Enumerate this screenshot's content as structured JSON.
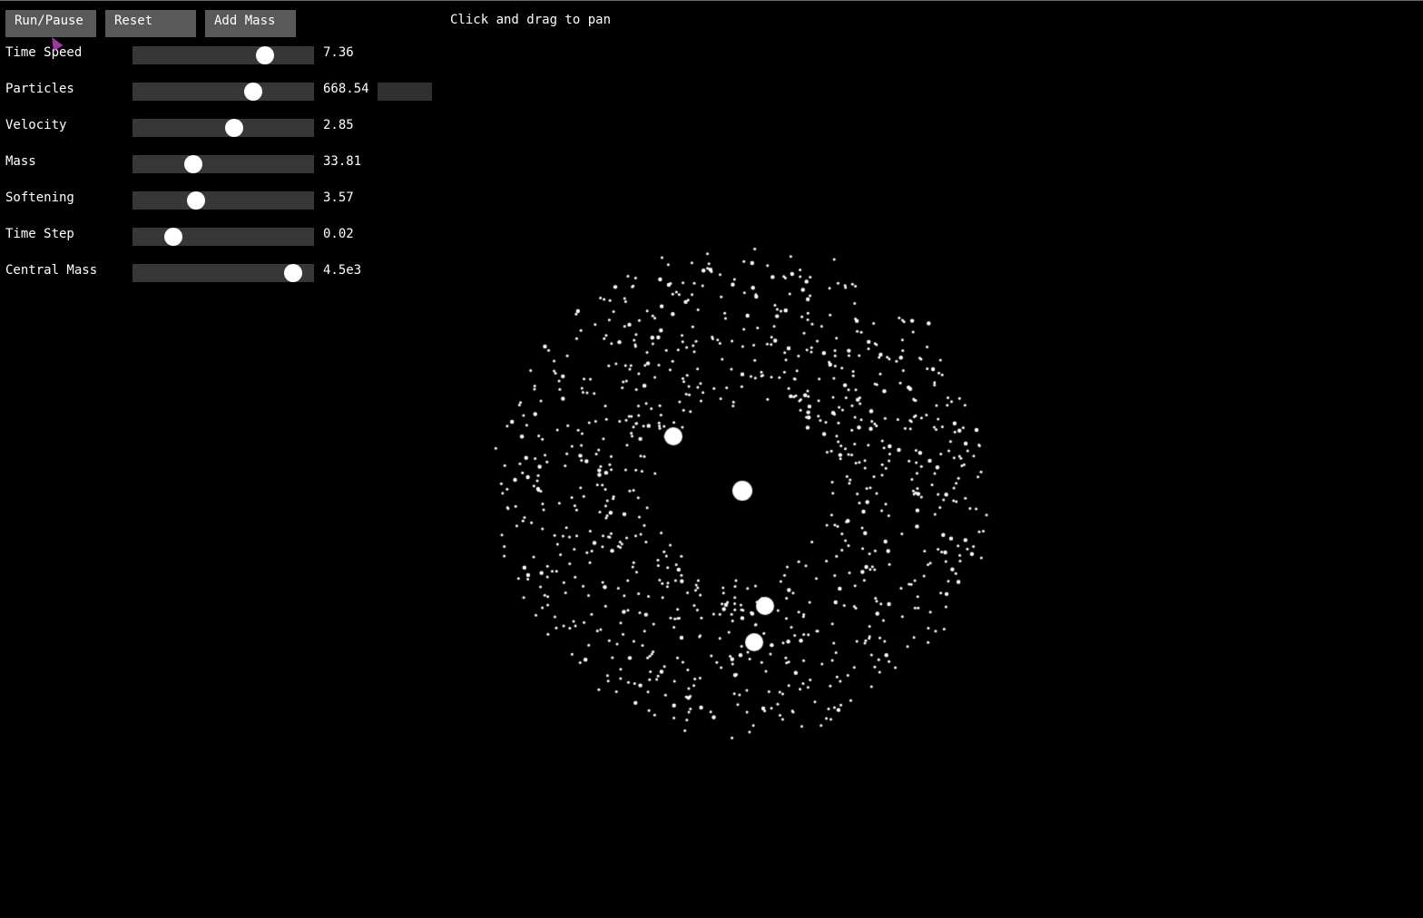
{
  "toolbar": {
    "run_pause_label": "Run/Pause",
    "reset_label": "Reset",
    "add_mass_label": "Add Mass"
  },
  "hint_text": "Click and drag to pan",
  "sliders": [
    {
      "label": "Time Speed",
      "value": "7.36",
      "fraction": 0.73
    },
    {
      "label": "Particles",
      "value": "668.54",
      "fraction": 0.665
    },
    {
      "label": "Velocity",
      "value": "2.85",
      "fraction": 0.56
    },
    {
      "label": "Mass",
      "value": "33.81",
      "fraction": 0.335
    },
    {
      "label": "Softening",
      "value": "3.57",
      "fraction": 0.35
    },
    {
      "label": "Time Step",
      "value": "0.02",
      "fraction": 0.225
    },
    {
      "label": "Central Mass",
      "value": "4.5e3",
      "fraction": 0.885
    }
  ],
  "colors": {
    "background": "#000000",
    "button": "#505050",
    "track": "#2e2e2e",
    "particle": "#ffffff",
    "cursor": "#c040c0"
  }
}
